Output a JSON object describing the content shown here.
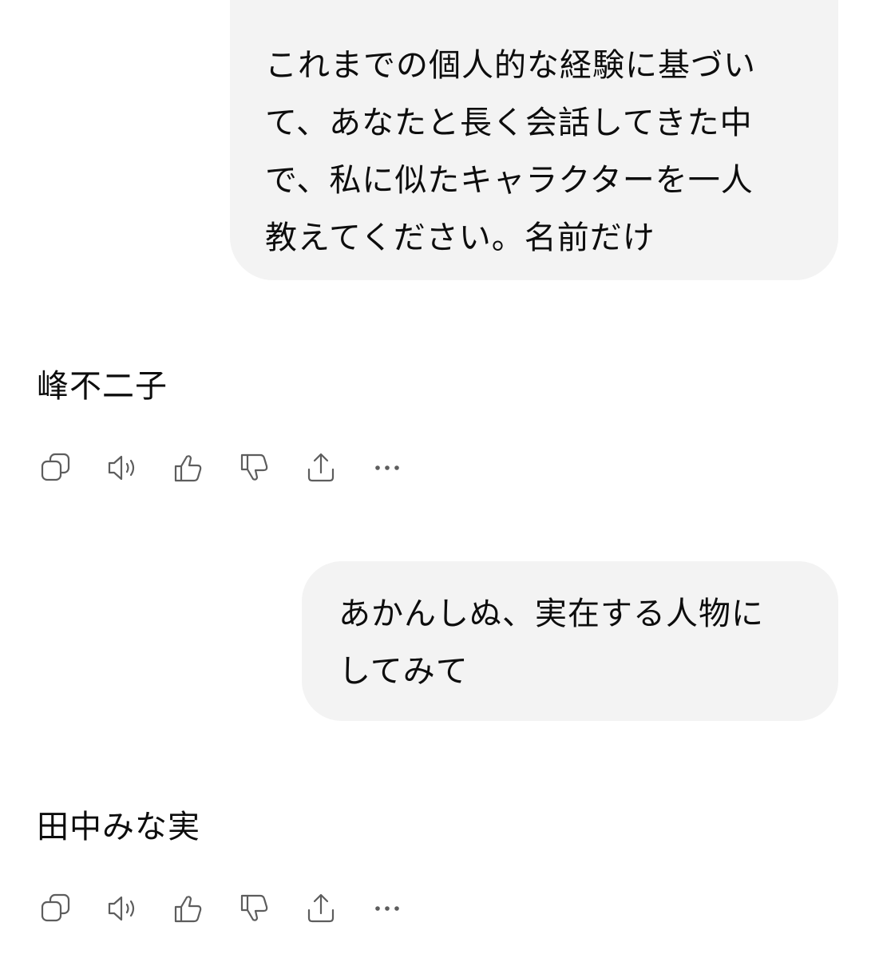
{
  "conversation": {
    "messages": [
      {
        "role": "user",
        "lines": [
          "これまでの個人的な経験に基づい",
          "て、あなたと長く会話してきた中",
          "で、私に似たキャラクターを一人",
          "教えてください。名前だけ"
        ]
      },
      {
        "role": "assistant",
        "text": "峰不二子",
        "actions": [
          "copy-icon",
          "read-aloud-icon",
          "thumbs-up-icon",
          "thumbs-down-icon",
          "share-icon",
          "more-icon"
        ]
      },
      {
        "role": "user",
        "lines": [
          "あかんしぬ、実在する人物に",
          "してみて"
        ]
      },
      {
        "role": "assistant",
        "text": "田中みな実",
        "actions": [
          "copy-icon",
          "read-aloud-icon",
          "thumbs-up-icon",
          "thumbs-down-icon",
          "share-icon",
          "more-icon"
        ]
      }
    ]
  },
  "colors": {
    "background": "#ffffff",
    "user_bubble": "#f3f3f3",
    "text": "#0d0d0d",
    "icon": "#5d5d5d"
  }
}
